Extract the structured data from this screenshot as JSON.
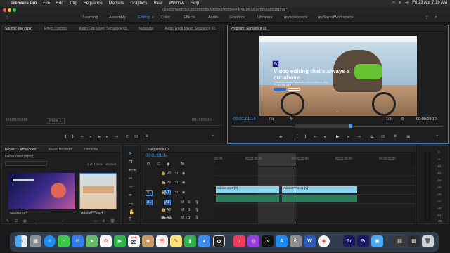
{
  "menubar": {
    "app": "Premiere Pro",
    "items": [
      "File",
      "Edit",
      "Clip",
      "Sequence",
      "Markers",
      "Graphics",
      "View",
      "Window",
      "Help"
    ],
    "clock": "Fri 23 Apr  7:18 AM"
  },
  "titlebar": {
    "path": "/Users/larengs/Documents/Adobe/Premiere Pro/14.0/DemoVideo.prproj *"
  },
  "workspaces": [
    "Learning",
    "Assembly",
    "Editing",
    "Color",
    "Effects",
    "Audio",
    "Graphics",
    "Libraries",
    "myworkspace",
    "mySavedWorkspace"
  ],
  "active_workspace": "Editing",
  "source_panel": {
    "tabs": [
      "Source: (no clips)",
      "Effect Controls",
      "Audio Clip Mixer: Sequence 03",
      "Metadata",
      "Audio Track Mixer: Sequence 03"
    ],
    "left_tc": "00;00;00;00",
    "right_tc": "00;00;00;00",
    "page": "Page 1"
  },
  "program_panel": {
    "tab": "Program: Sequence 03",
    "current_tc": "00:01:01:14",
    "fit": "Fit",
    "ratio": "1/3",
    "duration": "00:00:28:16",
    "video": {
      "headline": "Video editing that's always a cut above.",
      "subline": "Create pro-quality videos for social platforms, film, TV and the web.",
      "logo_text": "Pr"
    }
  },
  "project_panel": {
    "tabs": [
      "Project: DemoVideo",
      "Media Browser",
      "Libraries"
    ],
    "file": "DemoVideo.prproj",
    "selection": "1 of 4 items selected",
    "items": [
      "adobe.mp4",
      "AdobePP.mp4"
    ]
  },
  "timeline": {
    "tab": "Sequence 03",
    "timecode": "00:01:01:14",
    "ruler": [
      "00:00",
      "00:00:30:00",
      "00:01:00:00",
      "00:01:30:00",
      "00:02:00:00"
    ],
    "video_tracks": [
      "V3",
      "V2",
      "V1"
    ],
    "audio_tracks": [
      "A1",
      "A2",
      "A3"
    ],
    "master": "Master",
    "master_value": "0.0",
    "clips": [
      {
        "track": "V1",
        "name": "adobe.mp4 [V]",
        "color": "#8fd4ee"
      },
      {
        "track": "V1",
        "name": "AdobePP.mp4 [V]",
        "color": "#8fd4ee"
      }
    ]
  },
  "meters": {
    "labels": [
      "0",
      "-6",
      "-12",
      "-18",
      "-24",
      "-30",
      "-36",
      "-42",
      "-48",
      "-54"
    ],
    "unit": "dB"
  },
  "dock": {
    "apps": [
      "Finder",
      "Launchpad",
      "Safari",
      "Messages",
      "Mail",
      "Maps",
      "Photos",
      "FaceTime",
      "Calendar",
      "Contacts",
      "Reminders",
      "Notes",
      "Numbers",
      "Keynote",
      "Music",
      "Podcasts",
      "TV",
      "App Store",
      "System Preferences",
      "Word",
      "Chrome",
      "Premiere Pro",
      "Premiere Pro",
      "Preview",
      "Terminal",
      "Trash"
    ],
    "calendar_date": "23",
    "calendar_month": "APR"
  },
  "colors": {
    "accent": "#3e9cf6",
    "clip_video": "#8fd4ee",
    "clip_audio": "#2f7a5a",
    "playhead": "#3e9cf6"
  }
}
